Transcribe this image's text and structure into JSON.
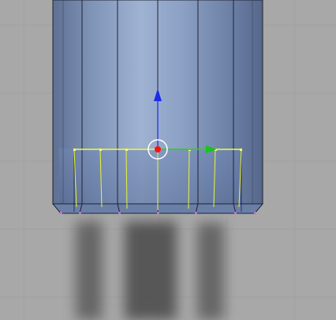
{
  "viewport": {
    "name": "3D viewport",
    "background_color": "#a8a8a8",
    "grid_color": "#9d9d9d",
    "mesh_fill_color": "#7f93b5",
    "mesh_edge_color": "#1f2433",
    "selected_edge_color": "#f2ff3a",
    "vertex_color": "#c074c9",
    "axis_colors": {
      "x": "#19c31f",
      "z": "#1a2be6"
    },
    "object_origin_color": "#ff1010",
    "shadow_color": "#4f4f4f"
  }
}
